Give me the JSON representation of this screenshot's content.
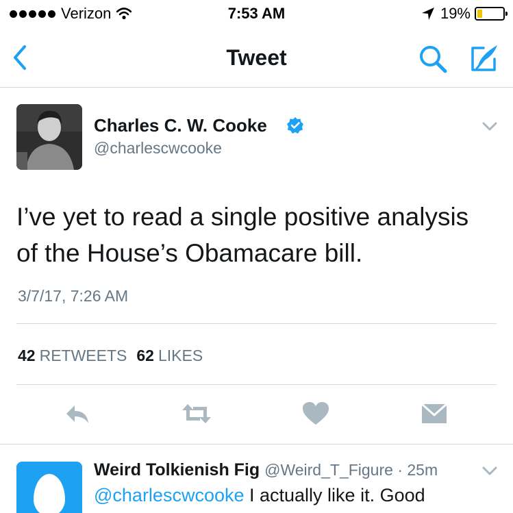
{
  "status_bar": {
    "carrier": "Verizon",
    "time": "7:53 AM",
    "battery": "19%",
    "battery_level": 0.19,
    "battery_color": "#f0c400"
  },
  "nav": {
    "title": "Tweet",
    "back_icon": "chevron-left-icon",
    "search_icon": "search-icon",
    "compose_icon": "compose-icon",
    "accent": "#1da1f2"
  },
  "tweet": {
    "author_name": "Charles C. W. Cooke",
    "handle": "@charlescwcooke",
    "verified": true,
    "text": "I’ve yet to read a single positive analysis of the House’s Obamacare bill.",
    "timestamp": "3/7/17, 7:26 AM",
    "retweets_count": "42",
    "retweets_label": "RETWEETS",
    "likes_count": "62",
    "likes_label": "LIKES"
  },
  "actions": [
    {
      "name": "reply",
      "icon": "reply-icon"
    },
    {
      "name": "retweet",
      "icon": "retweet-icon"
    },
    {
      "name": "like",
      "icon": "heart-icon"
    },
    {
      "name": "message",
      "icon": "envelope-icon"
    }
  ],
  "reply": {
    "author_name": "Weird Tolkienish Fig",
    "meta": "@Weird_T_Figure · 25m",
    "mention": "@charlescwcooke",
    "text": " I actually like it. Good"
  },
  "colors": {
    "text": "#14171a",
    "secondary": "#657786",
    "icon_gray": "#aab8c2",
    "divider": "#d5d9dc"
  }
}
